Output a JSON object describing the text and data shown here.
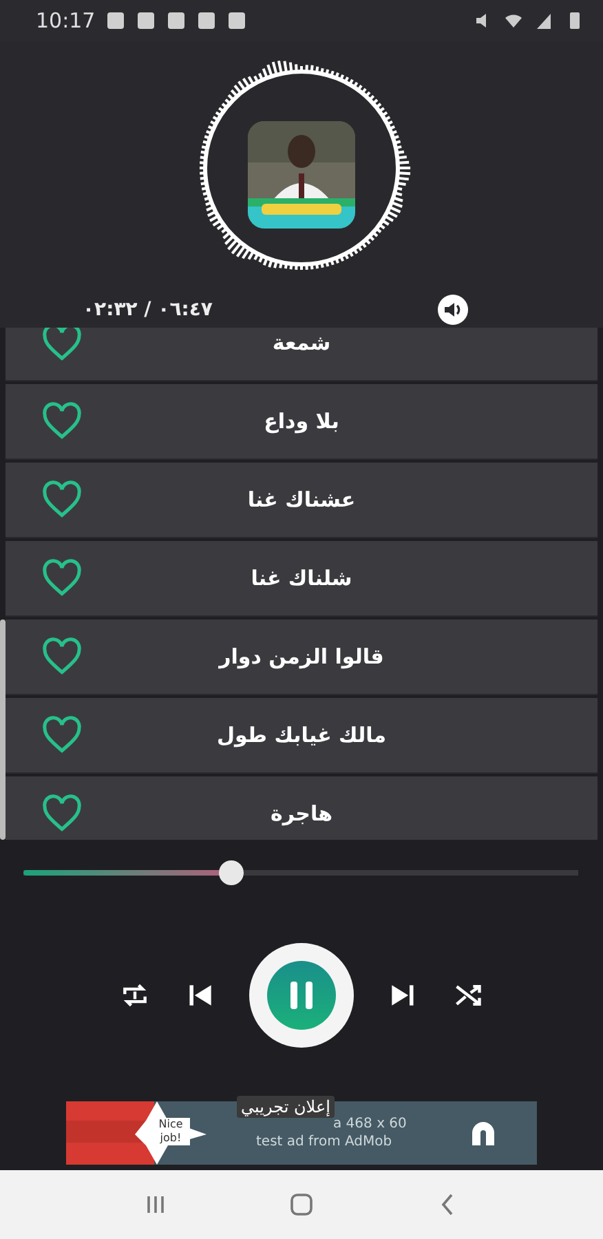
{
  "status_bar": {
    "time": "10:17"
  },
  "player": {
    "elapsed_total": "٠٦:٤٧ / ٠٢:٣٢"
  },
  "songs": [
    {
      "title": "شمعة",
      "favorite": false
    },
    {
      "title": "بلا وداع",
      "favorite": false
    },
    {
      "title": "عشناك غنا",
      "favorite": false
    },
    {
      "title": "شلناك غنا",
      "favorite": false
    },
    {
      "title": "قالوا الزمن دوار",
      "favorite": false
    },
    {
      "title": "مالك غيابك طول",
      "favorite": false
    },
    {
      "title": "هاجرة",
      "favorite": false
    }
  ],
  "seek": {
    "level": 0.375
  },
  "ad": {
    "badge": "إعلان تجريبي",
    "star_text": "Nice job!",
    "line_1": "a 468 x 60",
    "line_2": "test ad from AdMob"
  }
}
